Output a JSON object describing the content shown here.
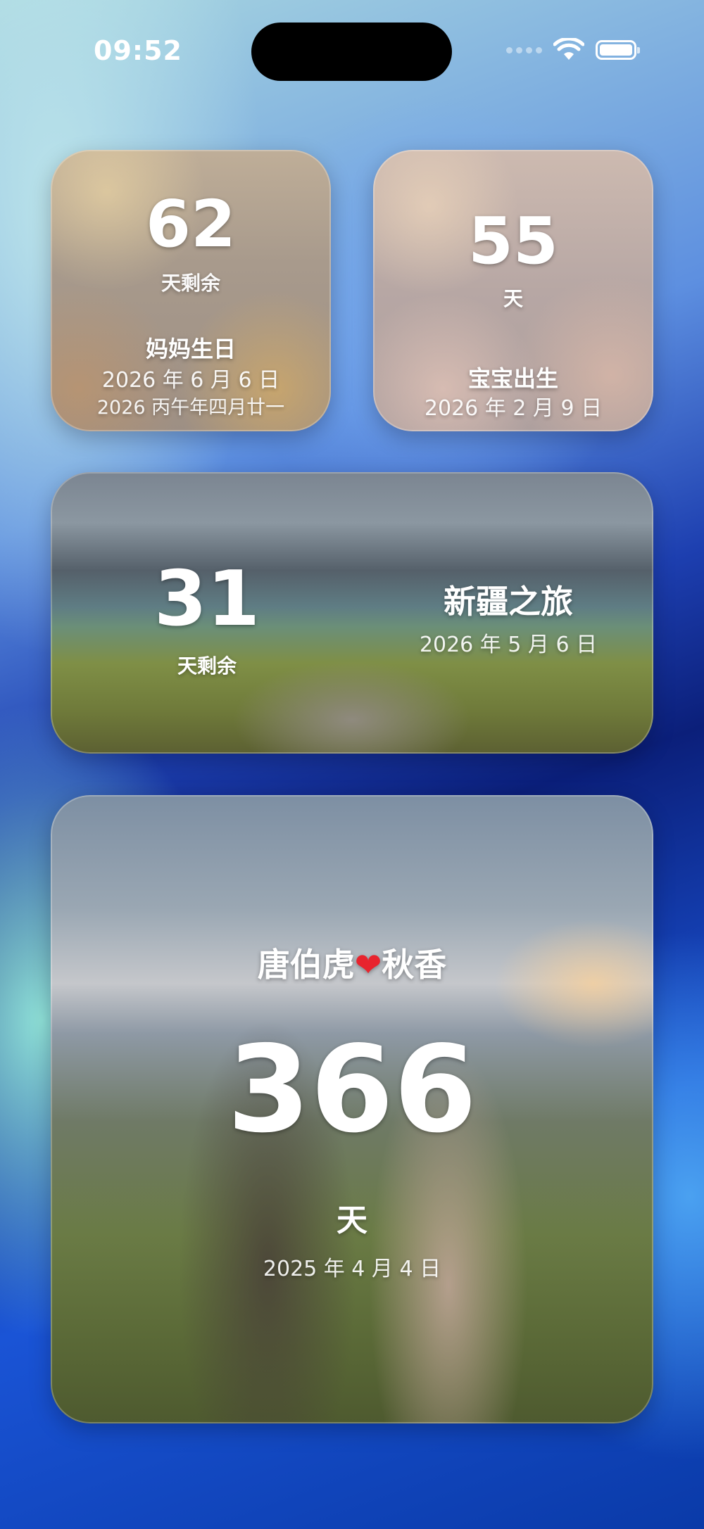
{
  "status_bar": {
    "time": "09:52"
  },
  "widgets": {
    "mom_birthday": {
      "days": "62",
      "unit": "天剩余",
      "title": "妈妈生日",
      "date": "2026 年 6 月 6 日",
      "lunar_date": "2026 丙午年四月廿一"
    },
    "baby_birth": {
      "days": "55",
      "unit": "天",
      "title": "宝宝出生",
      "date": "2026 年 2 月 9 日"
    },
    "xinjiang_trip": {
      "days": "31",
      "unit": "天剩余",
      "title": "新疆之旅",
      "date": "2026 年 5 月 6 日"
    },
    "anniversary": {
      "title_left": "唐伯虎",
      "title_heart": "❤",
      "title_right": "秋香",
      "days": "366",
      "unit": "天",
      "date": "2025 年 4 月 4 日"
    }
  },
  "icons": [
    "wifi-icon",
    "battery-icon",
    "cellular-signal-icon",
    "heart-icon"
  ],
  "colors": {
    "heart": "#e8242e"
  }
}
